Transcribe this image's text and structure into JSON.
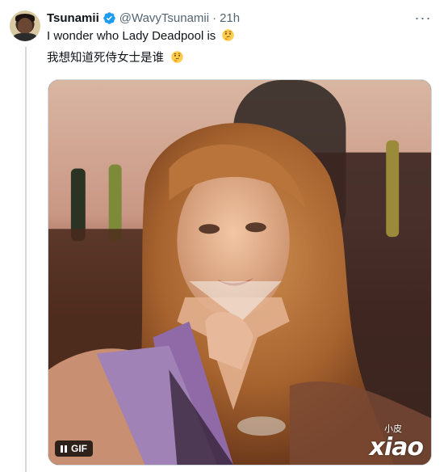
{
  "tweet": {
    "display_name": "Tsunamii",
    "handle": "@WavyTsunamii",
    "separator": "·",
    "time": "21h",
    "text_line1": "I wonder who Lady Deadpool is",
    "text_line2": "我想知道死侍女士是谁",
    "more_label": "···"
  },
  "media": {
    "badge_label": "GIF",
    "watermark_small": "小皮",
    "watermark_large": "xiao"
  },
  "icons": {
    "verified": "verified-badge-icon",
    "thinking": "thinking-face-emoji",
    "pause": "pause-icon",
    "more": "more-options-icon"
  },
  "colors": {
    "verified_blue": "#1d9bf0",
    "secondary_text": "#536471",
    "primary_text": "#0f1419",
    "thread_line": "#cfd9de"
  }
}
